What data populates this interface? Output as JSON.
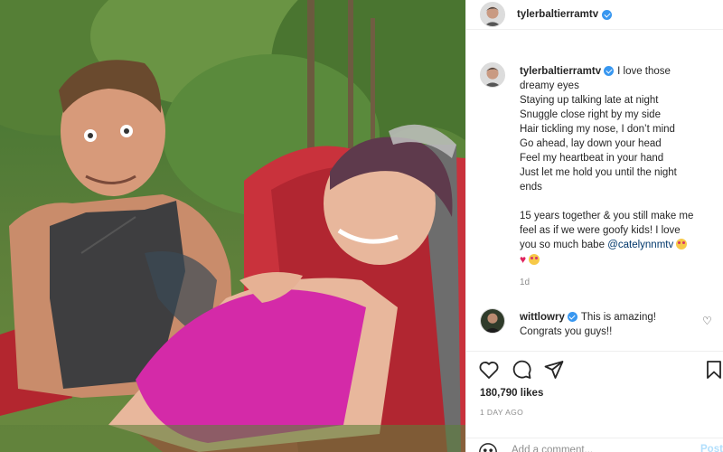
{
  "post": {
    "author": "tylerbaltierramtv",
    "author_verified": true
  },
  "caption": {
    "username": "tylerbaltierramtv",
    "lines": [
      "I love those",
      "dreamy eyes",
      "Staying up talking late at night",
      "Snuggle close right by my side",
      "Hair tickling my nose, I don’t mind",
      "Go ahead, lay down your head",
      "Feel my heartbeat in your hand",
      "Just let me hold you until the night",
      "ends"
    ],
    "para2_lines": [
      "15 years together & you still make me",
      "feel as if we were goofy kids! I love",
      "you so much babe"
    ],
    "mention": "@catelynnmtv",
    "time": "1d"
  },
  "comment": {
    "username": "wittlowry",
    "verified": true,
    "line1": "This is amazing!",
    "line2": "Congrats you guys!!"
  },
  "actions": {
    "likes": "180,790 likes",
    "timestamp": "1 DAY AGO"
  },
  "add_comment": {
    "placeholder": "Add a comment...",
    "post_label": "Post"
  },
  "colors": {
    "verified": "#3897f0",
    "mention": "#00376b",
    "post_button": "#b2dffc"
  },
  "icons": {
    "like": "heart-icon",
    "comment": "comment-icon",
    "share": "share-icon",
    "save": "bookmark-icon",
    "emoji": "smile-icon"
  }
}
